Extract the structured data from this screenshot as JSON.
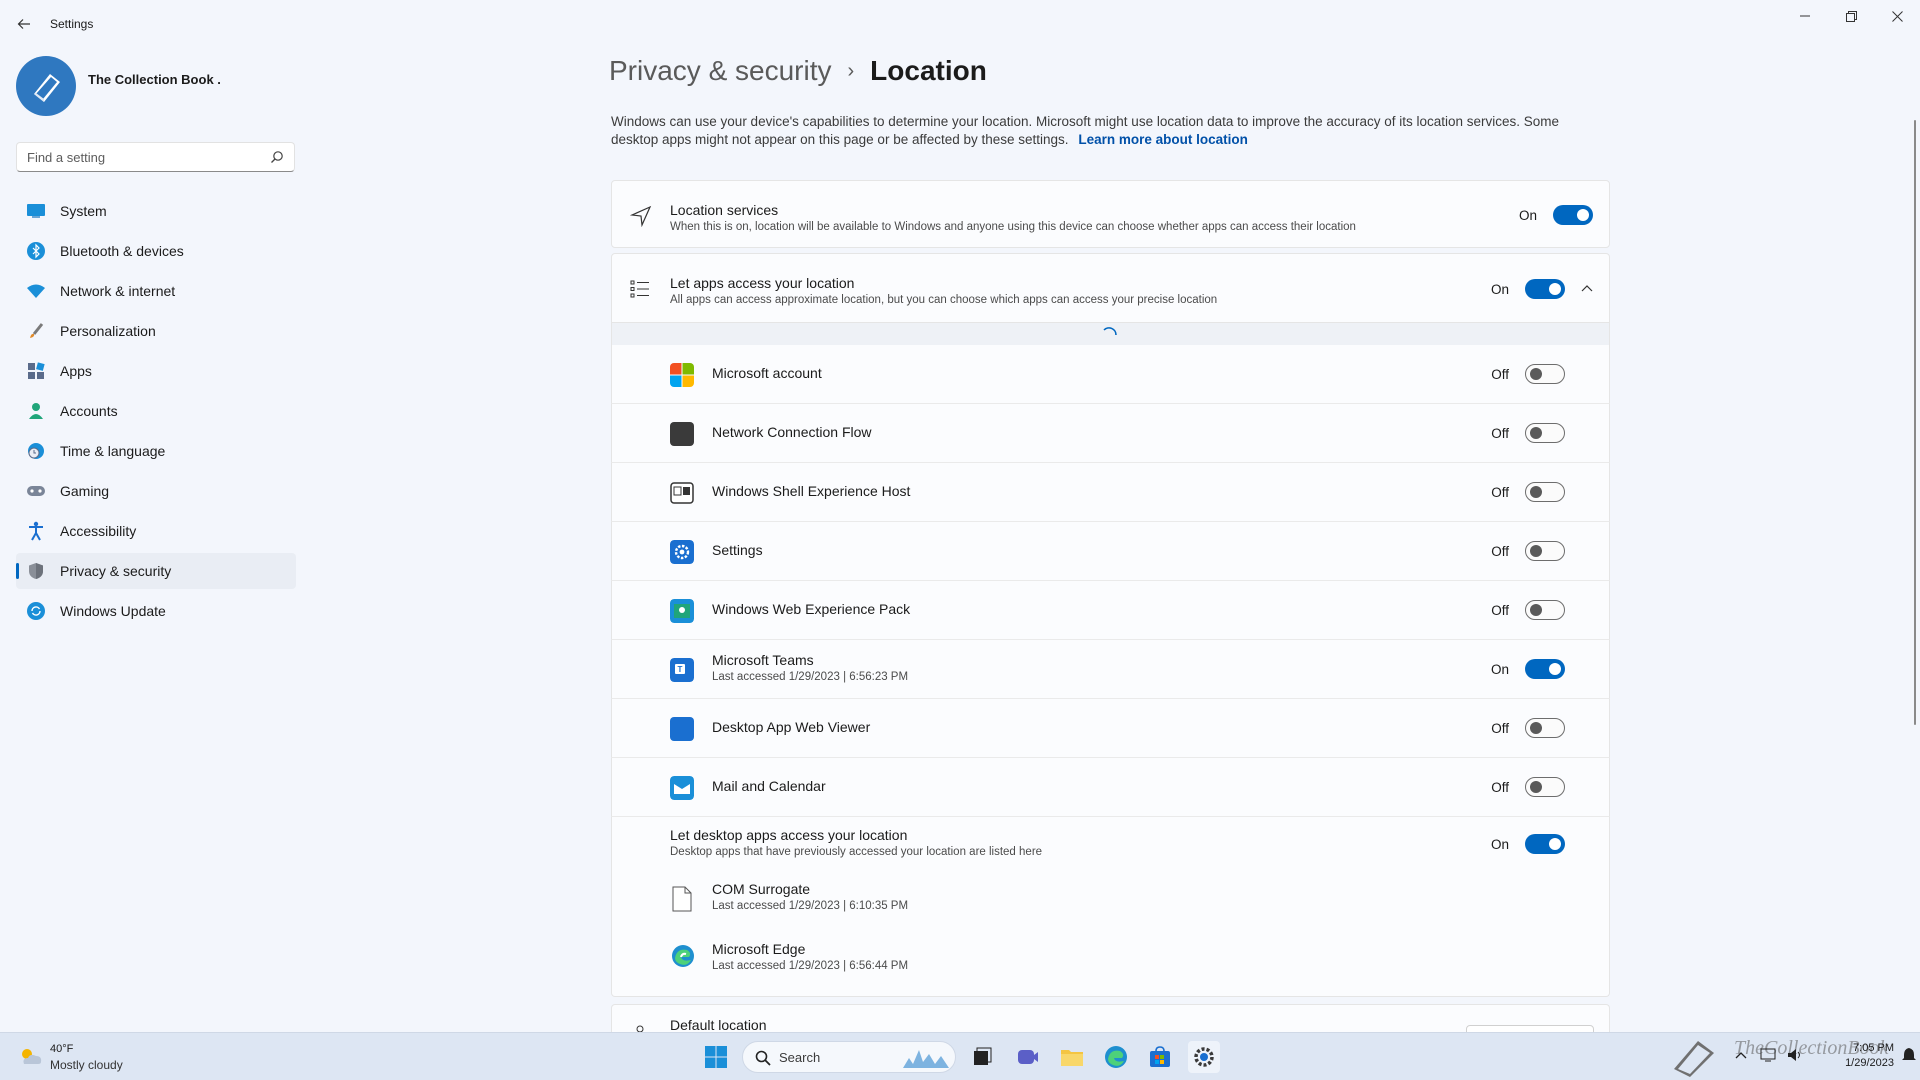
{
  "window": {
    "title": "Settings"
  },
  "profile": {
    "name": "The Collection Book ."
  },
  "search": {
    "placeholder": "Find a setting"
  },
  "nav": [
    {
      "label": "System",
      "icon": "monitor-icon"
    },
    {
      "label": "Bluetooth & devices",
      "icon": "bluetooth-icon"
    },
    {
      "label": "Network & internet",
      "icon": "wifi-icon"
    },
    {
      "label": "Personalization",
      "icon": "brush-icon"
    },
    {
      "label": "Apps",
      "icon": "apps-icon"
    },
    {
      "label": "Accounts",
      "icon": "person-icon"
    },
    {
      "label": "Time & language",
      "icon": "globe-clock-icon"
    },
    {
      "label": "Gaming",
      "icon": "gamepad-icon"
    },
    {
      "label": "Accessibility",
      "icon": "accessibility-icon"
    },
    {
      "label": "Privacy & security",
      "icon": "shield-icon",
      "active": true
    },
    {
      "label": "Windows Update",
      "icon": "update-icon"
    }
  ],
  "breadcrumb": {
    "parent": "Privacy & security",
    "separator": "›",
    "current": "Location"
  },
  "description": {
    "text": "Windows can use your device's capabilities to determine your location. Microsoft might use location data to improve the accuracy of its location services. Some desktop apps might not appear on this page or be affected by these settings.",
    "link": "Learn more about location"
  },
  "location_services": {
    "title": "Location services",
    "subtitle": "When this is on, location will be available to Windows and anyone using this device can choose whether apps can access their location",
    "state": "On"
  },
  "apps_access": {
    "title": "Let apps access your location",
    "subtitle": "All apps can access approximate location, but you can choose which apps can access your precise location",
    "state": "On"
  },
  "apps": [
    {
      "name": "Microsoft account",
      "sub": "",
      "state": "Off",
      "icon": "microsoft-logo-icon"
    },
    {
      "name": "Network Connection Flow",
      "sub": "",
      "state": "Off",
      "icon": "app-tile-icon"
    },
    {
      "name": "Windows Shell Experience Host",
      "sub": "",
      "state": "Off",
      "icon": "shell-window-icon"
    },
    {
      "name": "Settings",
      "sub": "",
      "state": "Off",
      "icon": "settings-gear-icon"
    },
    {
      "name": "Windows Web Experience Pack",
      "sub": "",
      "state": "Off",
      "icon": "web-experience-icon"
    },
    {
      "name": "Microsoft Teams",
      "sub": "Last accessed 1/29/2023  |  6:56:23 PM",
      "state": "On",
      "icon": "teams-icon"
    },
    {
      "name": "Desktop App Web Viewer",
      "sub": "",
      "state": "Off",
      "icon": "web-viewer-icon"
    },
    {
      "name": "Mail and Calendar",
      "sub": "",
      "state": "Off",
      "icon": "mail-icon"
    }
  ],
  "desktop_apps": {
    "title": "Let desktop apps access your location",
    "subtitle": "Desktop apps that have previously accessed your location are listed here",
    "state": "On",
    "items": [
      {
        "name": "COM Surrogate",
        "sub": "Last accessed 1/29/2023  |  6:10:35 PM",
        "icon": "document-icon"
      },
      {
        "name": "Microsoft Edge",
        "sub": "Last accessed 1/29/2023  |  6:56:44 PM",
        "icon": "edge-icon"
      }
    ]
  },
  "default_location": {
    "title": "Default location"
  },
  "taskbar": {
    "weather_temp": "40°F",
    "weather_cond": "Mostly cloudy",
    "search_label": "Search",
    "time": "7:05 PM",
    "date": "1/29/2023",
    "watermark": "TheCollectionBook"
  },
  "colors": {
    "accent": "#0067c0",
    "background": "#f3f6fc",
    "taskbar": "#dde6f3"
  }
}
